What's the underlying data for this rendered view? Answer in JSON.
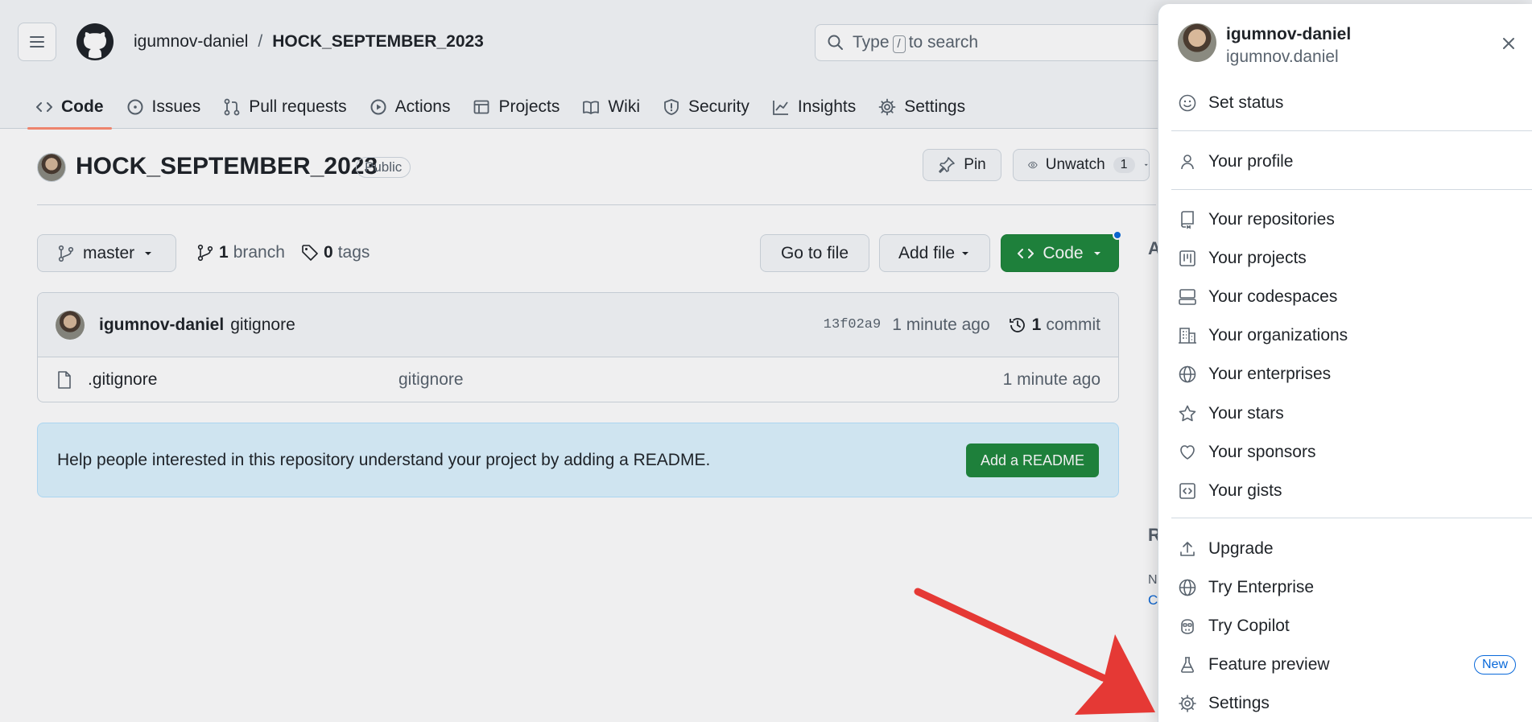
{
  "header": {
    "owner": "igumnov-daniel",
    "separator": "/",
    "repo": "HOCK_SEPTEMBER_2023",
    "search": {
      "prefix": "Type",
      "key": "/",
      "suffix": "to search"
    }
  },
  "tabs": [
    {
      "label": "Code",
      "icon": "code-icon"
    },
    {
      "label": "Issues",
      "icon": "issue-icon"
    },
    {
      "label": "Pull requests",
      "icon": "pull-request-icon"
    },
    {
      "label": "Actions",
      "icon": "play-icon"
    },
    {
      "label": "Projects",
      "icon": "table-icon"
    },
    {
      "label": "Wiki",
      "icon": "book-icon"
    },
    {
      "label": "Security",
      "icon": "shield-icon"
    },
    {
      "label": "Insights",
      "icon": "graph-icon"
    },
    {
      "label": "Settings",
      "icon": "gear-icon"
    }
  ],
  "repo_header": {
    "title": "HOCK_SEPTEMBER_2023",
    "visibility": "Public",
    "pin_label": "Pin",
    "unwatch_label": "Unwatch",
    "watch_count": "1"
  },
  "toolbar": {
    "branch": "master",
    "branch_count": "1",
    "branch_word": "branch",
    "tag_count": "0",
    "tag_word": "tags",
    "goto_file": "Go to file",
    "add_file": "Add file",
    "code_button": "Code"
  },
  "latest_commit": {
    "author": "igumnov-daniel",
    "message": "gitignore",
    "sha": "13f02a9",
    "time": "1 minute ago",
    "commit_count": "1",
    "commit_word": "commit"
  },
  "files": [
    {
      "name": ".gitignore",
      "message": "gitignore",
      "time": "1 minute ago"
    }
  ],
  "readme_banner": {
    "text": "Help people interested in this repository understand your project by adding a README.",
    "button": "Add a README"
  },
  "sidebar_partial": {
    "about_initial": "A",
    "releases_initial": "R",
    "r1": "N",
    "r2": "C"
  },
  "user_menu": {
    "login": "igumnov-daniel",
    "name": "igumnov.daniel",
    "set_status": "Set status",
    "items_group1": [
      "Your profile"
    ],
    "items_group2": [
      "Your repositories",
      "Your projects",
      "Your codespaces",
      "Your organizations",
      "Your enterprises",
      "Your stars",
      "Your sponsors",
      "Your gists"
    ],
    "items_group3": [
      "Upgrade",
      "Try Enterprise",
      "Try Copilot",
      "Feature preview",
      "Settings"
    ],
    "new_badge": "New"
  },
  "colors": {
    "accent_green": "#1f883d",
    "tab_underline": "#fd8c73",
    "arrow": "#e53935",
    "link_blue": "#0969da"
  }
}
